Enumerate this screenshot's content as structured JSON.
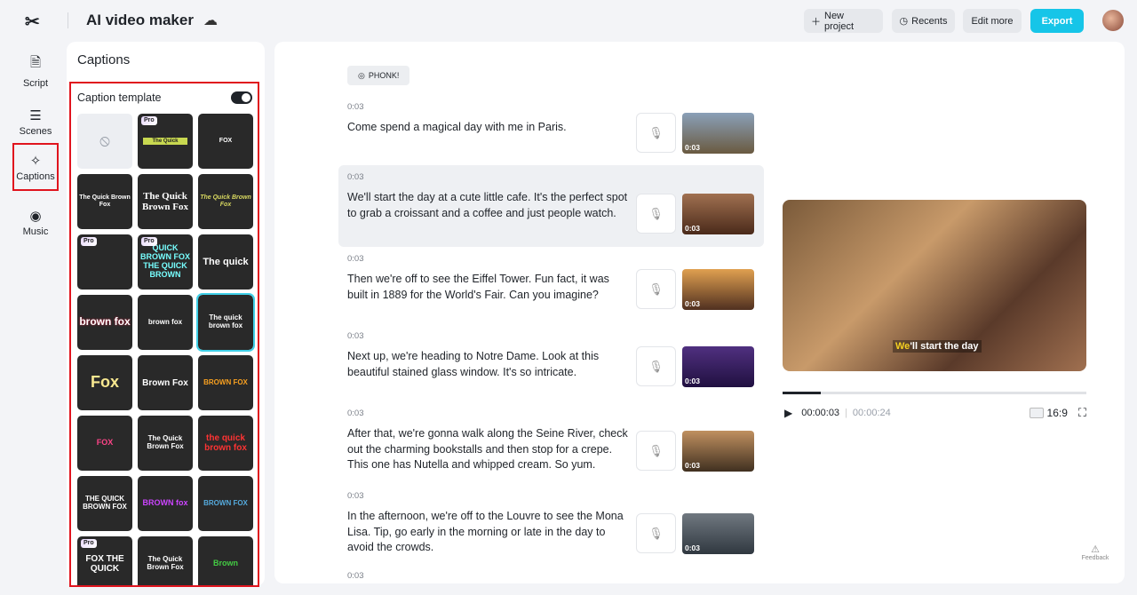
{
  "header": {
    "app_title": "AI video maker",
    "new_project": "New project",
    "recents": "Recents",
    "edit_more": "Edit more",
    "export": "Export"
  },
  "nav": [
    {
      "label": "Script",
      "icon": "script-icon"
    },
    {
      "label": "Scenes",
      "icon": "scenes-icon"
    },
    {
      "label": "Captions",
      "icon": "captions-icon",
      "active": true
    },
    {
      "label": "Music",
      "icon": "music-icon"
    }
  ],
  "captions": {
    "title": "Captions",
    "template_label": "Caption template",
    "template_enabled": true,
    "templates": [
      {
        "text": "",
        "kind": "none"
      },
      {
        "text": "The Quick",
        "pro": true
      },
      {
        "text": "FOX"
      },
      {
        "text": "The Quick Brown Fox"
      },
      {
        "text": "The Quick Brown Fox"
      },
      {
        "text": "The Quick Brown Fox"
      },
      {
        "text": "",
        "pro": true
      },
      {
        "text": "QUICK BROWN FOX THE QUICK BROWN",
        "pro": true
      },
      {
        "text": "The quick"
      },
      {
        "text": "brown fox"
      },
      {
        "text": "brown fox"
      },
      {
        "text": "The quick brown fox",
        "selected": true
      },
      {
        "text": "Fox"
      },
      {
        "text": "Brown Fox"
      },
      {
        "text": "BROWN FOX"
      },
      {
        "text": "FOX"
      },
      {
        "text": "The Quick Brown Fox"
      },
      {
        "text": "the quick brown fox"
      },
      {
        "text": "THE QUICK BROWN FOX"
      },
      {
        "text": "BROWN fox"
      },
      {
        "text": "BROWN FOX"
      },
      {
        "text": "FOX THE QUICK",
        "pro": true
      },
      {
        "text": "The Quick Brown Fox"
      },
      {
        "text": "Brown"
      }
    ],
    "pro_label": "Pro"
  },
  "script": {
    "music_tag": "PHONK!",
    "items": [
      {
        "time": "0:03",
        "text": "Come spend a magical day with me in Paris.",
        "thumb_time": "0:03"
      },
      {
        "time": "0:03",
        "text": "We'll start the day at a cute little cafe. It's the perfect spot to grab a croissant and a coffee and just people watch.",
        "thumb_time": "0:03",
        "highlighted": true
      },
      {
        "time": "0:03",
        "text": "Then we're off to see the Eiffel Tower. Fun fact, it was built in 1889 for the World's Fair. Can you imagine?",
        "thumb_time": "0:03"
      },
      {
        "time": "0:03",
        "text": "Next up, we're heading to Notre Dame. Look at this beautiful stained glass window. It's so intricate.",
        "thumb_time": "0:03"
      },
      {
        "time": "0:03",
        "text": "After that, we're gonna walk along the Seine River, check out the charming bookstalls and then stop for a crepe. This one has Nutella and whipped cream. So yum.",
        "thumb_time": "0:03"
      },
      {
        "time": "0:03",
        "text": "In the afternoon, we're off to the Louvre to see the Mona Lisa. Tip, go early in the morning or late in the day to avoid the crowds.",
        "thumb_time": "0:03"
      },
      {
        "time": "0:03",
        "text": "",
        "thumb_time": ""
      }
    ]
  },
  "preview": {
    "subtitle_hl": "We",
    "subtitle_rest": "'ll start the day",
    "current_time": "00:00:03",
    "total_time": "00:00:24",
    "progress": 0.125,
    "aspect": "16:9"
  },
  "feedback": "Feedback"
}
